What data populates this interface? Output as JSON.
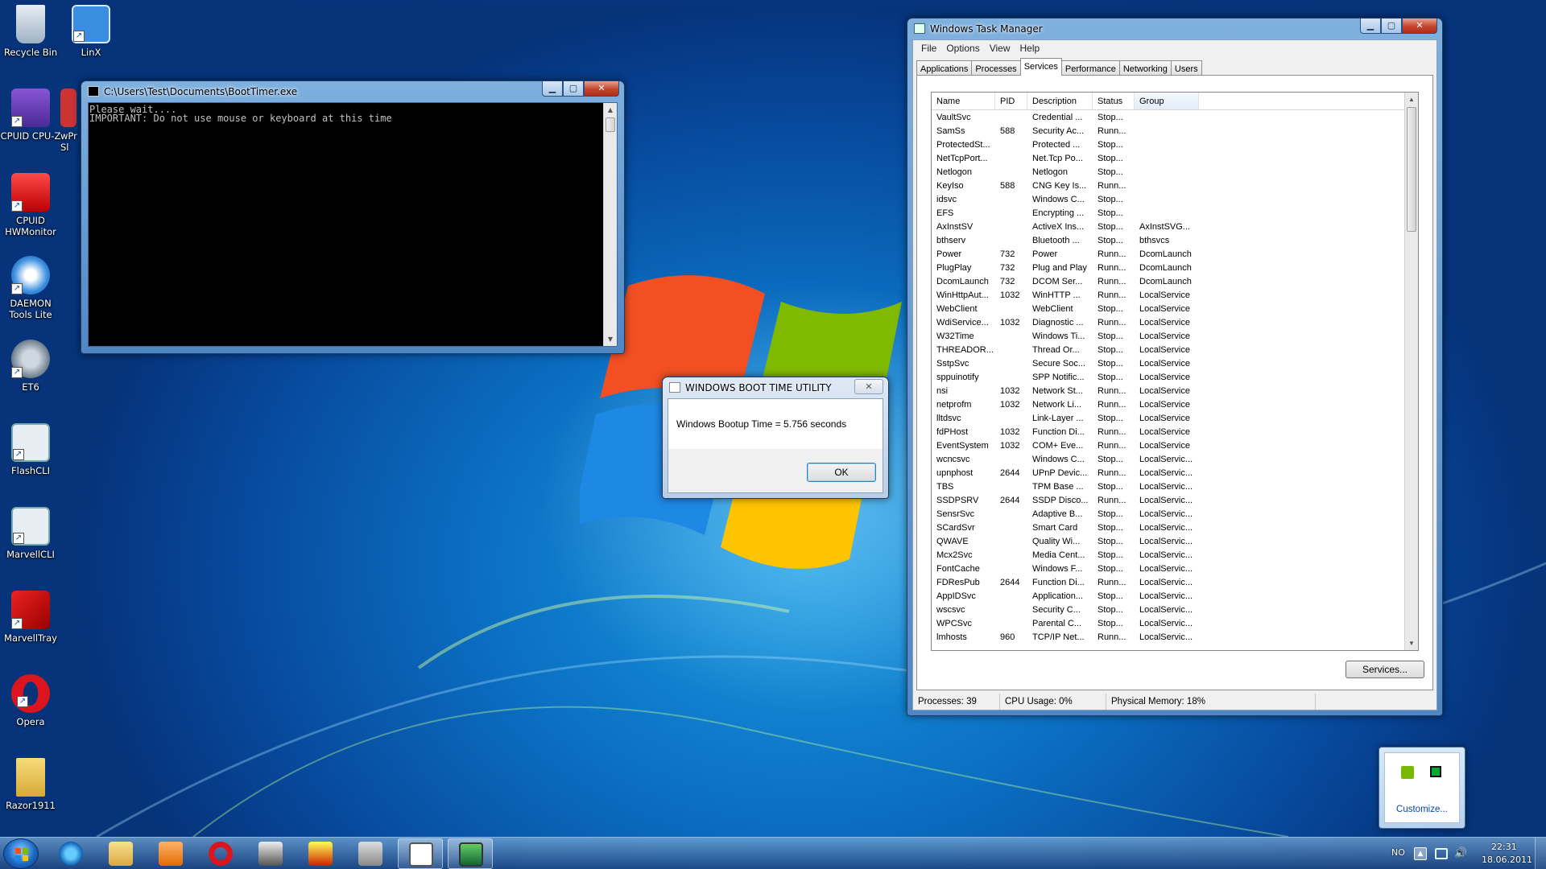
{
  "desktop": {
    "icons": [
      {
        "label": "Recycle Bin",
        "icon": "recycle-bin-icon"
      },
      {
        "label": "LinX",
        "icon": "linx-icon"
      },
      {
        "label": "CPUID CPU-Z",
        "icon": "cpu-z-icon"
      },
      {
        "label": "wPr Sl",
        "icon": "wprime-icon"
      },
      {
        "label": "CPUID HWMonitor",
        "icon": "hwmonitor-icon"
      },
      {
        "label": "DAEMON Tools Lite",
        "icon": "daemon-tools-icon"
      },
      {
        "label": "ET6",
        "icon": "et6-icon"
      },
      {
        "label": "FlashCLI",
        "icon": "flashcli-icon"
      },
      {
        "label": "MarvellCLI",
        "icon": "marvellcli-icon"
      },
      {
        "label": "MarvellTray",
        "icon": "marvelltray-icon"
      },
      {
        "label": "Opera",
        "icon": "opera-icon"
      },
      {
        "label": "Razor1911",
        "icon": "razor1911-folder-icon"
      }
    ]
  },
  "console": {
    "title": "C:\\Users\\Test\\Documents\\BootTimer.exe",
    "lines": [
      "Please wait....",
      "IMPORTANT: Do not use mouse or keyboard at this time"
    ]
  },
  "dialog": {
    "title": "WINDOWS BOOT TIME UTILITY",
    "message": "Windows Bootup Time =  5.756  seconds",
    "ok_label": "OK"
  },
  "taskmgr": {
    "title": "Windows Task Manager",
    "menu": [
      "File",
      "Options",
      "View",
      "Help"
    ],
    "tabs": [
      "Applications",
      "Processes",
      "Services",
      "Performance",
      "Networking",
      "Users"
    ],
    "active_tab": "Services",
    "columns": [
      "Name",
      "PID",
      "Description",
      "Status",
      "Group"
    ],
    "rows": [
      [
        "VaultSvc",
        "",
        "Credential ...",
        "Stop...",
        ""
      ],
      [
        "SamSs",
        "588",
        "Security Ac...",
        "Runn...",
        ""
      ],
      [
        "ProtectedSt...",
        "",
        "Protected ...",
        "Stop...",
        ""
      ],
      [
        "NetTcpPort...",
        "",
        "Net.Tcp Po...",
        "Stop...",
        ""
      ],
      [
        "Netlogon",
        "",
        "Netlogon",
        "Stop...",
        ""
      ],
      [
        "KeyIso",
        "588",
        "CNG Key Is...",
        "Runn...",
        ""
      ],
      [
        "idsvc",
        "",
        "Windows C...",
        "Stop...",
        ""
      ],
      [
        "EFS",
        "",
        "Encrypting ...",
        "Stop...",
        ""
      ],
      [
        "AxInstSV",
        "",
        "ActiveX Ins...",
        "Stop...",
        "AxInstSVG..."
      ],
      [
        "bthserv",
        "",
        "Bluetooth ...",
        "Stop...",
        "bthsvcs"
      ],
      [
        "Power",
        "732",
        "Power",
        "Runn...",
        "DcomLaunch"
      ],
      [
        "PlugPlay",
        "732",
        "Plug and Play",
        "Runn...",
        "DcomLaunch"
      ],
      [
        "DcomLaunch",
        "732",
        "DCOM Ser...",
        "Runn...",
        "DcomLaunch"
      ],
      [
        "WinHttpAut...",
        "1032",
        "WinHTTP ...",
        "Runn...",
        "LocalService"
      ],
      [
        "WebClient",
        "",
        "WebClient",
        "Stop...",
        "LocalService"
      ],
      [
        "WdiService...",
        "1032",
        "Diagnostic ...",
        "Runn...",
        "LocalService"
      ],
      [
        "W32Time",
        "",
        "Windows Ti...",
        "Stop...",
        "LocalService"
      ],
      [
        "THREADOR...",
        "",
        "Thread Or...",
        "Stop...",
        "LocalService"
      ],
      [
        "SstpSvc",
        "",
        "Secure Soc...",
        "Stop...",
        "LocalService"
      ],
      [
        "sppuinotify",
        "",
        "SPP Notific...",
        "Stop...",
        "LocalService"
      ],
      [
        "nsi",
        "1032",
        "Network St...",
        "Runn...",
        "LocalService"
      ],
      [
        "netprofm",
        "1032",
        "Network Li...",
        "Runn...",
        "LocalService"
      ],
      [
        "lltdsvc",
        "",
        "Link-Layer ...",
        "Stop...",
        "LocalService"
      ],
      [
        "fdPHost",
        "1032",
        "Function Di...",
        "Runn...",
        "LocalService"
      ],
      [
        "EventSystem",
        "1032",
        "COM+ Eve...",
        "Runn...",
        "LocalService"
      ],
      [
        "wcncsvc",
        "",
        "Windows C...",
        "Stop...",
        "LocalServic..."
      ],
      [
        "upnphost",
        "2644",
        "UPnP Devic...",
        "Runn...",
        "LocalServic..."
      ],
      [
        "TBS",
        "",
        "TPM Base ...",
        "Stop...",
        "LocalServic..."
      ],
      [
        "SSDPSRV",
        "2644",
        "SSDP Disco...",
        "Runn...",
        "LocalServic..."
      ],
      [
        "SensrSvc",
        "",
        "Adaptive B...",
        "Stop...",
        "LocalServic..."
      ],
      [
        "SCardSvr",
        "",
        "Smart Card",
        "Stop...",
        "LocalServic..."
      ],
      [
        "QWAVE",
        "",
        "Quality Wi...",
        "Stop...",
        "LocalServic..."
      ],
      [
        "Mcx2Svc",
        "",
        "Media Cent...",
        "Stop...",
        "LocalServic..."
      ],
      [
        "FontCache",
        "",
        "Windows F...",
        "Stop...",
        "LocalServic..."
      ],
      [
        "FDResPub",
        "2644",
        "Function Di...",
        "Runn...",
        "LocalServic..."
      ],
      [
        "AppIDSvc",
        "",
        "Application...",
        "Stop...",
        "LocalServic..."
      ],
      [
        "wscsvc",
        "",
        "Security C...",
        "Stop...",
        "LocalServic..."
      ],
      [
        "WPCSvc",
        "",
        "Parental C...",
        "Stop...",
        "LocalServic..."
      ],
      [
        "lmhosts",
        "960",
        "TCP/IP Net...",
        "Runn...",
        "LocalServic..."
      ]
    ],
    "services_button": "Services...",
    "status": {
      "processes": "Processes: 39",
      "cpu": "CPU Usage: 0%",
      "memory": "Physical Memory: 18%"
    }
  },
  "tray_popup": {
    "customize": "Customize..."
  },
  "taskbar": {
    "items": [
      "internet-explorer-icon",
      "explorer-folder-icon",
      "media-player-icon",
      "opera-icon",
      "flash-tool-icon",
      "touch-bios-icon",
      "utility-icon",
      "boottimer-console-icon",
      "task-manager-icon"
    ],
    "language": "NO",
    "time": "22:31",
    "date": "18.06.2011"
  },
  "colors": {
    "desktop": "#0b6fc2",
    "console_bg": "#000000",
    "console_text": "#c0c0c0",
    "close_button": "#c4442d"
  }
}
